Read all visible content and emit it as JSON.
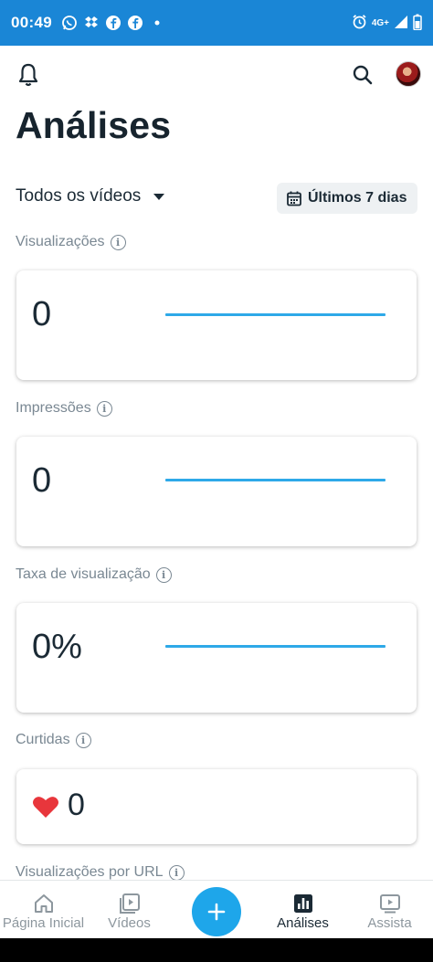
{
  "status_bar": {
    "time": "00:49",
    "network": "4G+",
    "icons": [
      "whatsapp-icon",
      "dropbox-icon",
      "facebook-icon",
      "facebook-icon",
      "dot-icon",
      "alarm-icon",
      "signal-icon",
      "battery-icon"
    ]
  },
  "header": {
    "title": "Análises",
    "icons": [
      "bell-icon",
      "search-icon",
      "avatar"
    ]
  },
  "filters": {
    "video_filter": "Todos os vídeos",
    "date_range": "Últimos 7 dias"
  },
  "metrics": [
    {
      "label": "Visualizações",
      "value": "0"
    },
    {
      "label": "Impressões",
      "value": "0"
    },
    {
      "label": "Taxa de visualização",
      "value": "0%"
    },
    {
      "label": "Curtidas",
      "value": "0"
    },
    {
      "label": "Visualizações por URL"
    }
  ],
  "bottom_nav": {
    "home": "Página Inicial",
    "videos": "Vídeos",
    "analytics": "Análises",
    "watch": "Assista",
    "active": "analytics"
  },
  "colors": {
    "status_bar": "#1a86d6",
    "accent": "#1ea6ea",
    "sparkline": "#2ea9e8",
    "heart": "#e8363c"
  }
}
